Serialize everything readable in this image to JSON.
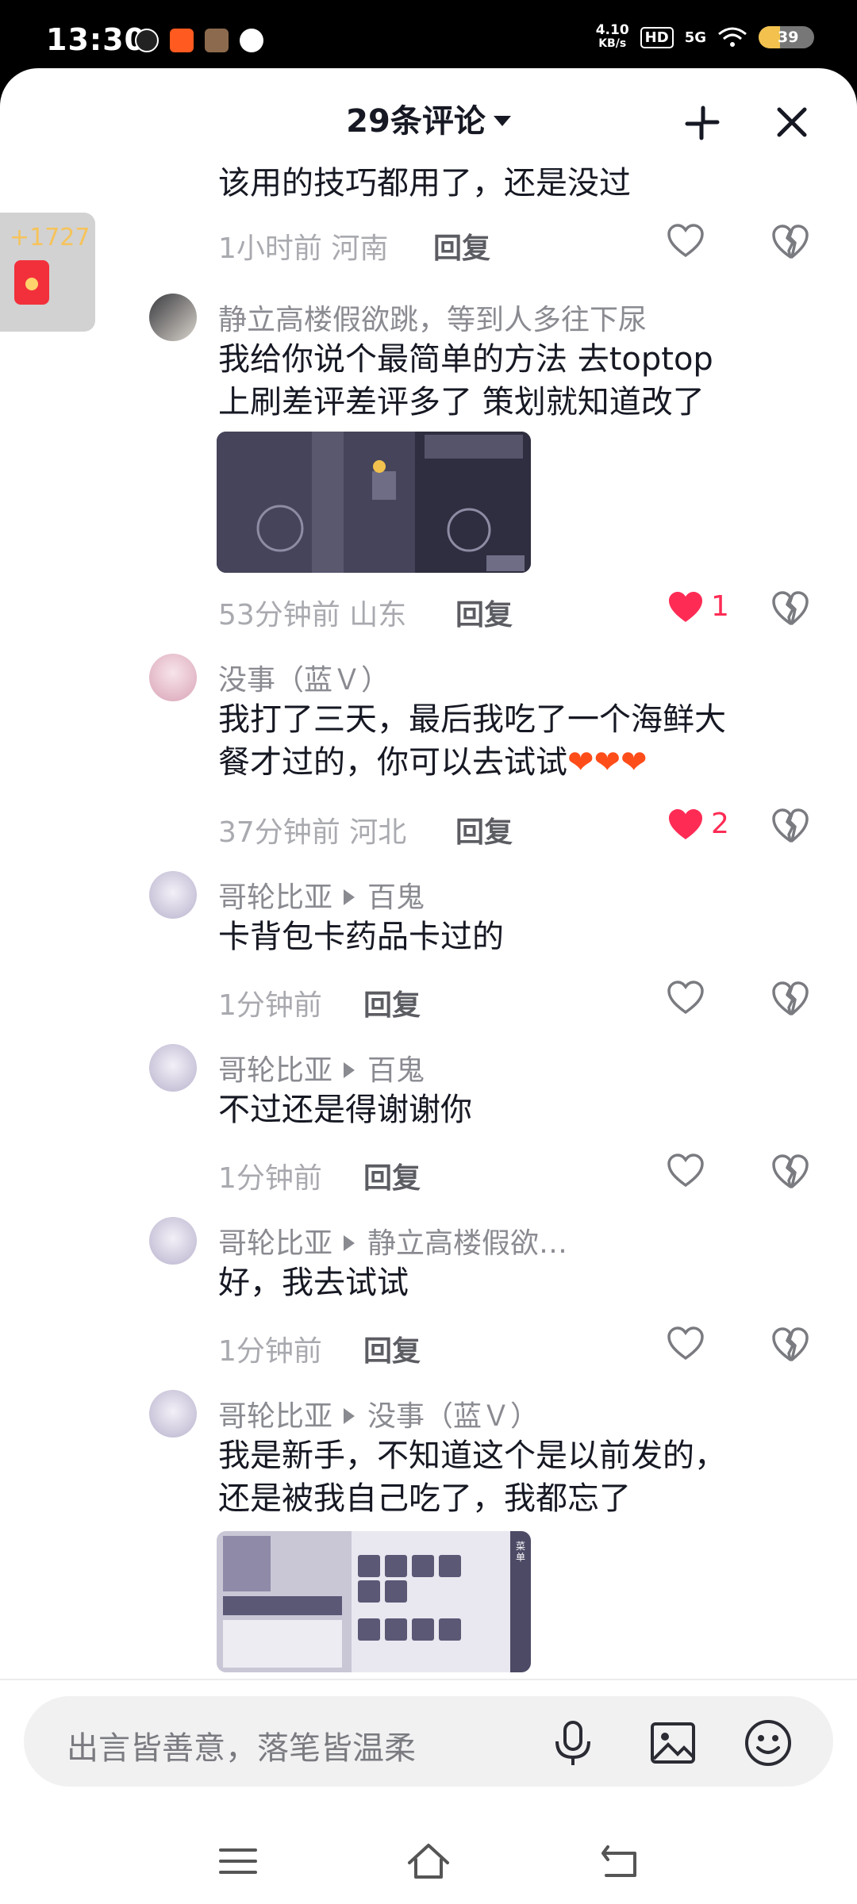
{
  "status_bar": {
    "time": "13:30",
    "net_speed_value": "4.10",
    "net_speed_unit": "KB/s",
    "hd": "HD",
    "signal": "5G",
    "battery": "39",
    "battery_level": 0.39
  },
  "header": {
    "title": "29条评论"
  },
  "red_packet": {
    "count": "+1727"
  },
  "comments": [
    {
      "text": "该用的技巧都用了，还是没过",
      "time_loc": "1小时前 河南",
      "reply": "回复"
    },
    {
      "name": "静立高楼假欲跳，等到人多往下尿",
      "line1": "我给你说个最简单的方法 去toptop",
      "line2": "上刷差评差评多了 策划就知道改了",
      "time_loc": "53分钟前 山东",
      "reply": "回复",
      "likes": "1"
    },
    {
      "name": "没事（蓝Ｖ）",
      "line1": "我打了三天，最后我吃了一个海鲜大",
      "line2": "餐才过的，你可以去试试",
      "time_loc": "37分钟前 河北",
      "reply": "回复",
      "likes": "2"
    },
    {
      "name": "哥轮比亚",
      "reply_to": "百鬼",
      "text": "卡背包卡药品卡过的",
      "time_loc": "1分钟前",
      "reply": "回复"
    },
    {
      "name": "哥轮比亚",
      "reply_to": "百鬼",
      "text": "不过还是得谢谢你",
      "time_loc": "1分钟前",
      "reply": "回复"
    },
    {
      "name": "哥轮比亚",
      "reply_to": "静立高楼假欲…",
      "text": "好，我去试试",
      "time_loc": "1分钟前",
      "reply": "回复"
    },
    {
      "name": "哥轮比亚",
      "reply_to": "没事（蓝Ｖ）",
      "line1": "我是新手，不知道这个是以前发的，",
      "line2": "还是被我自己吃了，我都忘了",
      "image_label": "菜单"
    }
  ],
  "input": {
    "placeholder": "出言皆善意，落笔皆温柔"
  },
  "colors": {
    "accent_like": "#fe2c55",
    "text_primary": "#161823",
    "text_secondary": "#8a8b91"
  },
  "icons": [
    "collapse-icon",
    "close-icon",
    "heart-icon",
    "broken-heart-icon",
    "mic-icon",
    "image-icon",
    "emoji-icon",
    "menu-icon",
    "home-icon",
    "back-icon"
  ]
}
